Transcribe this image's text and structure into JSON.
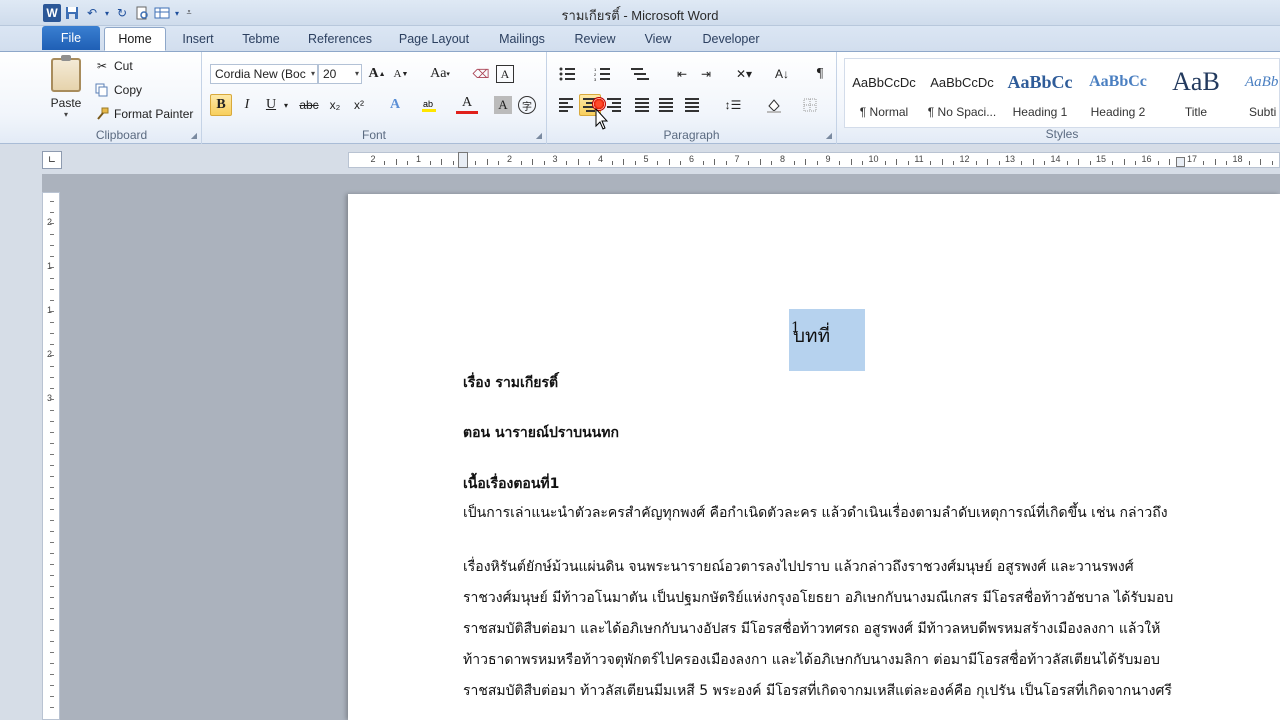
{
  "window": {
    "title": "รามเกียรติ์ - Microsoft Word"
  },
  "qat": {
    "logo": "W"
  },
  "tabs": [
    {
      "label": "File"
    },
    {
      "label": "Home"
    },
    {
      "label": "Insert"
    },
    {
      "label": "Tebme"
    },
    {
      "label": "References"
    },
    {
      "label": "Page Layout"
    },
    {
      "label": "Mailings"
    },
    {
      "label": "Review"
    },
    {
      "label": "View"
    },
    {
      "label": "Developer"
    }
  ],
  "ribbon": {
    "clipboard": {
      "label": "Clipboard",
      "paste": "Paste",
      "cut": "Cut",
      "copy": "Copy",
      "format_painter": "Format Painter"
    },
    "font": {
      "label": "Font",
      "font_name": "Cordia New (Boc",
      "font_size": "20",
      "grow": "A",
      "shrink": "A",
      "change_case": "Aa",
      "bold": "B",
      "italic": "I",
      "underline": "U",
      "strike": "abc",
      "subscript": "x₂",
      "superscript": "x²",
      "text_effects": "A",
      "font_color": "A",
      "char_shading": "A"
    },
    "paragraph": {
      "label": "Paragraph",
      "show_marks": "¶"
    },
    "styles": {
      "label": "Styles",
      "items": [
        {
          "sample": "AaBbCcDc",
          "name": "¶ Normal"
        },
        {
          "sample": "AaBbCcDc",
          "name": "¶ No Spaci..."
        },
        {
          "sample": "AaBbCc",
          "name": "Heading 1"
        },
        {
          "sample": "AaBbCc",
          "name": "Heading 2"
        },
        {
          "sample": "AaB",
          "name": "Title"
        },
        {
          "sample": "AaBb",
          "name": "Subti"
        }
      ]
    }
  },
  "ruler": {
    "numbers": [
      "2",
      "1",
      "1",
      "2",
      "3",
      "4",
      "5",
      "6",
      "7",
      "8",
      "9",
      "10",
      "11",
      "12",
      "13",
      "14",
      "15",
      "16",
      "17",
      "18"
    ]
  },
  "vruler": {
    "numbers": [
      "2",
      "1",
      "1",
      "2",
      "3"
    ]
  },
  "document": {
    "chapter": "บทที่",
    "chapter_num": "1",
    "title_line": "เรื่อง รามเกียรติ์",
    "episode_line": "ตอน นารายณ์ปราบนนทก",
    "plot_heading": "เนื้อเรื่องตอนที่1",
    "para1": "เป็นการเล่าแนะนำตัวละครสำคัญทุกพงศ์ คือกำเนิดตัวละคร แล้วดำเนินเรื่องตามลำดับเหตุการณ์ที่เกิดขึ้น เช่น กล่าวถึง",
    "para2_l1": "เรื่องหิรันต์ยักษ์ม้วนแผ่นดิน จนพระนารายณ์อวตารลงไปปราบ แล้วกล่าวถึงราชวงศ์มนุษย์ อสูรพงศ์ และวานรพงศ์",
    "para2_l2": "ราชวงศ์มนุษย์ มีท้าวอโนมาตัน เป็นปฐมกษัตริย์แห่งกรุงอโยธยา อภิเษกกับนางมณีเกสร มีโอรสชื่อท้าวอัชบาล ได้รับมอบ",
    "para2_l3": "ราชสมบัติสืบต่อมา และได้อภิเษกกับนางอัปสร มีโอรสชื่อท้าวทศรถ อสูรพงศ์ มีท้าวลหบดีพรหมสร้างเมืองลงกา แล้วให้",
    "para2_l4": "ท้าวธาดาพรหมหรือท้าวจตุพักตร์ไปครองเมืองลงกา และได้อภิเษกกับนางมลิกา ต่อมามีโอรสชื่อท้าวลัสเตียนได้รับมอบ",
    "para2_l5": "ราชสมบัติสืบต่อมา ท้าวลัสเตียนมีมเหสี 5 พระองค์ มีโอรสที่เกิดจากมเหสีแต่ละองค์คือ กุเปรัน เป็นโอรสที่เกิดจากนางศรี"
  }
}
